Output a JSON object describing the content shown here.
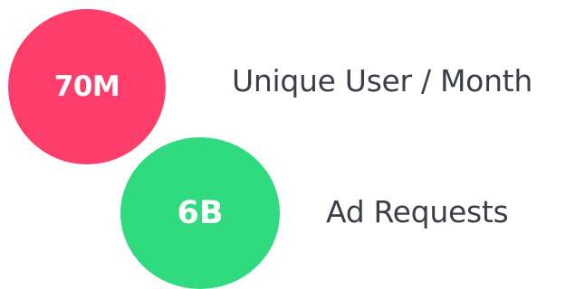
{
  "stats": [
    {
      "value": "70M",
      "label": "Unique User / Month",
      "color": "#fd3d6a"
    },
    {
      "value": "6B",
      "label": "Ad Requests",
      "color": "#30db80"
    }
  ]
}
